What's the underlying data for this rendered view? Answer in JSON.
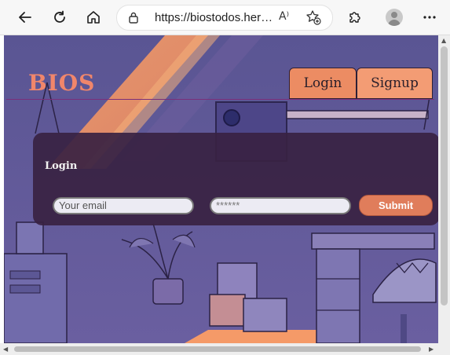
{
  "browser": {
    "url": "https://biostodos.herokuapp.com",
    "back_icon": "arrow-left-icon",
    "refresh_icon": "refresh-icon",
    "home_icon": "home-icon",
    "lock_icon": "lock-icon",
    "read_aloud_label": "A⁾",
    "favorites_icon": "star-add-icon",
    "extensions_icon": "puzzle-icon",
    "profile_icon": "avatar-icon",
    "menu_icon": "more-icon"
  },
  "site": {
    "brand": "BIOS",
    "nav": {
      "login": "Login",
      "signup": "Signup"
    },
    "login_panel": {
      "title": "Login",
      "email_placeholder": "Your email",
      "password_placeholder": "******",
      "submit": "Submit"
    }
  },
  "colors": {
    "brand": "#f0866b",
    "background": "#5b5893",
    "panel": "#382242",
    "accent": "#e07d5b"
  }
}
